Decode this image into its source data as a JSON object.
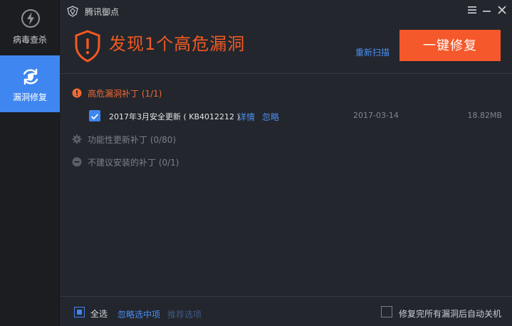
{
  "app": {
    "title": "腾讯御点"
  },
  "sidebar": {
    "items": [
      {
        "label": "病毒查杀",
        "icon": "lightning-icon",
        "active": false
      },
      {
        "label": "漏洞修复",
        "icon": "refresh-shield-icon",
        "active": true
      }
    ]
  },
  "header": {
    "headline": "发现1个高危漏洞",
    "rescan_label": "重新扫描",
    "fix_button_label": "一键修复"
  },
  "groups": {
    "high_risk": {
      "label": "高危漏洞补丁 (1/1)",
      "patches": [
        {
          "checked": true,
          "name": "2017年3月安全更新 ( KB4012212 )",
          "detail_label": "详情",
          "ignore_label": "忽略",
          "date": "2017-03-14",
          "size": "18.82MB"
        }
      ]
    },
    "functional": {
      "label": "功能性更新补丁 (0/80)"
    },
    "not_recommended": {
      "label": "不建议安装的补丁 (0/1)"
    }
  },
  "footer": {
    "select_all_label": "全选",
    "ignore_selected_label": "忽略选中项",
    "recommended_label": "推荐选项",
    "auto_shutdown_label": "修复完所有漏洞后自动关机"
  },
  "colors": {
    "accent_blue": "#3f86f0",
    "danger_orange": "#f5582a",
    "link_blue": "#4a8ff5",
    "background": "#23262d",
    "sidebar_bg": "#1b1d21"
  }
}
